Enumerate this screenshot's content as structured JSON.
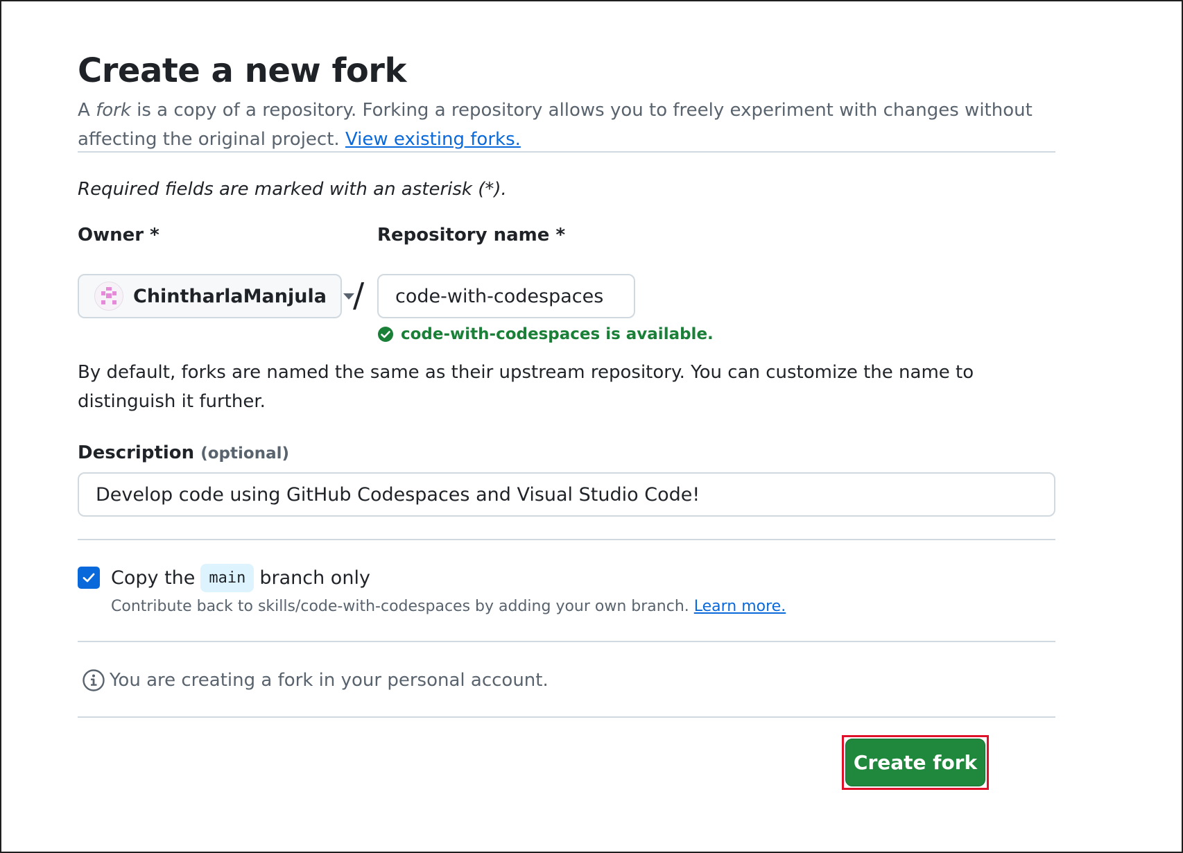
{
  "page": {
    "title": "Create a new fork",
    "intro_prefix": "A ",
    "intro_fork_word": "fork",
    "intro_text": " is a copy of a repository. Forking a repository allows you to freely experiment with changes without affecting the original project. ",
    "view_forks_link": "View existing forks.",
    "required_note": "Required fields are marked with an asterisk (*)."
  },
  "owner": {
    "label": "Owner *",
    "value": "ChintharlaManjula"
  },
  "separator": "/",
  "repository": {
    "label": "Repository name *",
    "value": "code-with-codespaces",
    "availability": "code-with-codespaces is available."
  },
  "naming_help": "By default, forks are named the same as their upstream repository. You can customize the name to distinguish it further.",
  "description": {
    "label": "Description",
    "optional": "(optional)",
    "value": "Develop code using GitHub Codespaces and Visual Studio Code!"
  },
  "copy_branch": {
    "checked": true,
    "prefix": "Copy the",
    "branch": "main",
    "suffix": "branch only",
    "help": "Contribute back to skills/code-with-codespaces by adding your own branch. ",
    "learn_more": "Learn more."
  },
  "info_note": "You are creating a fork in your personal account.",
  "create_button": "Create fork",
  "colors": {
    "primary_green": "#1f883d",
    "success_green": "#1a7f37",
    "link_blue": "#0969da",
    "highlight_red": "#e0102b"
  }
}
